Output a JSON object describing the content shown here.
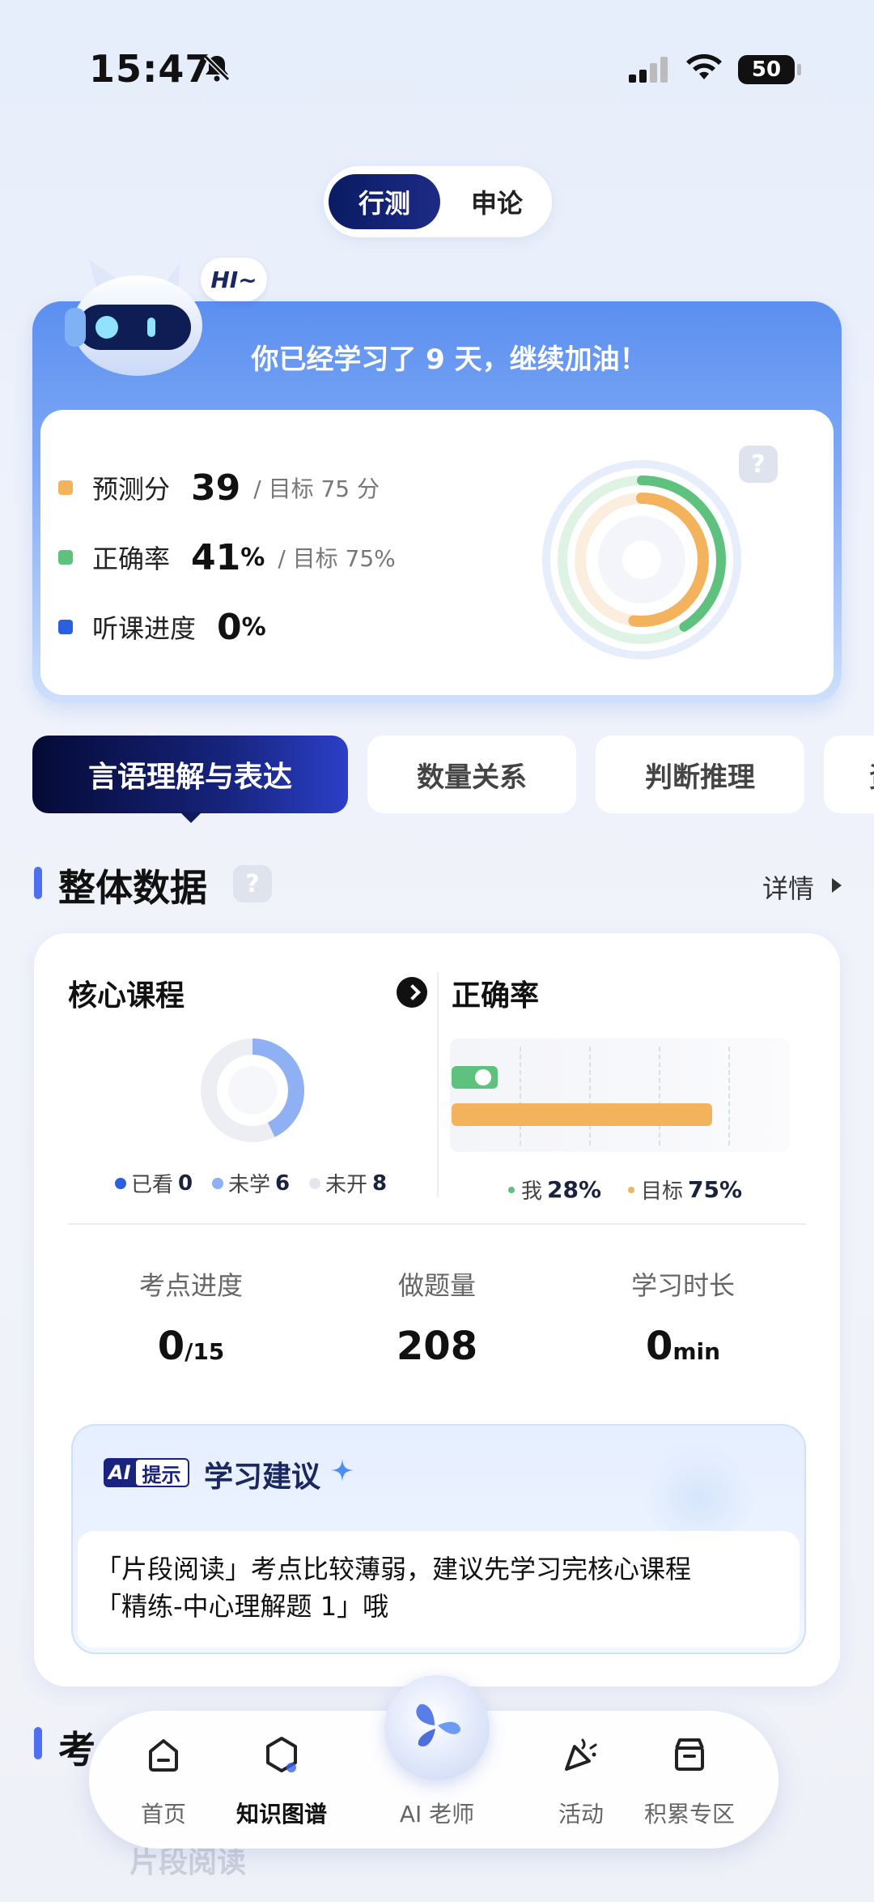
{
  "status_bar": {
    "time": "15:47",
    "battery": "50"
  },
  "segment": {
    "active": "行测",
    "inactive": "申论"
  },
  "summary": {
    "greeting_bubble": "HI~",
    "title": "你已经学习了 9 天，继续加油！",
    "metrics": [
      {
        "label": "预测分",
        "value": "39",
        "unit": "",
        "target": "/ 目标 75 分",
        "color": "#f2b35c"
      },
      {
        "label": "正确率",
        "value": "41",
        "unit": "%",
        "target": "/ 目标 75%",
        "color": "#5ec27e"
      },
      {
        "label": "听课进度",
        "value": "0",
        "unit": "%",
        "target": "",
        "color": "#2c5fe0"
      }
    ],
    "help": "?",
    "ring": {
      "score_ratio": 0.52,
      "accuracy_ratio": 0.41,
      "lecture_ratio": 0.0
    }
  },
  "tabs": [
    "言语理解与表达",
    "数量关系",
    "判断推理",
    "资"
  ],
  "overall": {
    "title": "整体数据",
    "help": "?",
    "detail": "详情",
    "core_course": {
      "title": "核心课程",
      "legend": [
        {
          "label": "已看",
          "value": "0",
          "color": "#2c5fe0"
        },
        {
          "label": "未学",
          "value": "6",
          "color": "#8fb0f3"
        },
        {
          "label": "未开",
          "value": "8",
          "color": "#e4e6ee"
        }
      ]
    },
    "accuracy": {
      "title": "正确率",
      "me_label": "我",
      "me_value": "28%",
      "me_ratio": 0.28,
      "target_label": "目标",
      "target_value": "75%",
      "target_ratio": 0.75,
      "me_color": "#5ec27e",
      "target_color": "#f2b35c"
    },
    "stats": [
      {
        "label": "考点进度",
        "value": "0",
        "suffix": "/15"
      },
      {
        "label": "做题量",
        "value": "208",
        "suffix": ""
      },
      {
        "label": "学习时长",
        "value": "0",
        "suffix": "min"
      }
    ],
    "tip": {
      "badge_ai": "AI",
      "badge_text": "提示",
      "title": "学习建议",
      "body_line1": "「片段阅读」考点比较薄弱，建议先学习完核心课程",
      "body_line2": "「精练-中心理解题 1」哦"
    }
  },
  "next_section": {
    "title": "考",
    "subtitle": "片段阅读"
  },
  "nav": {
    "items": [
      {
        "label": "首页",
        "icon": "home-icon"
      },
      {
        "label": "知识图谱",
        "icon": "hexagon-icon"
      },
      {
        "label": "AI 老师",
        "icon": "ai-orb-icon"
      },
      {
        "label": "活动",
        "icon": "party-popper-icon"
      },
      {
        "label": "积累专区",
        "icon": "archive-box-icon"
      }
    ],
    "active": "知识图谱"
  }
}
